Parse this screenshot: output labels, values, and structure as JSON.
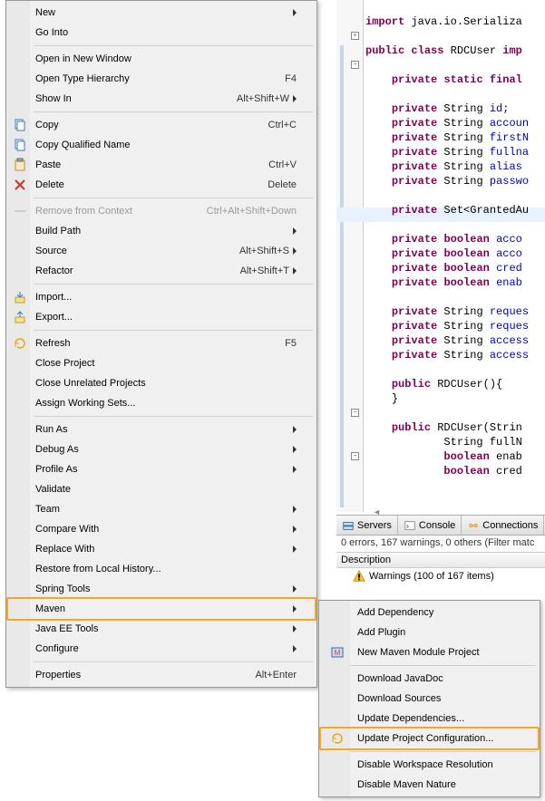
{
  "code": {
    "lines": [
      {
        "indent": 0,
        "tokens": [
          {
            "t": " ",
            "cls": ""
          }
        ]
      },
      {
        "indent": 0,
        "tokens": [
          {
            "t": "import",
            "cls": "kw"
          },
          {
            "t": " java.io.Serializa",
            "cls": ""
          }
        ]
      },
      {
        "indent": 0,
        "tokens": []
      },
      {
        "indent": 0,
        "tokens": [
          {
            "t": "public",
            "cls": "kw"
          },
          {
            "t": " ",
            "cls": ""
          },
          {
            "t": "class",
            "cls": "kw"
          },
          {
            "t": " RDCUser ",
            "cls": ""
          },
          {
            "t": "imp",
            "cls": "kw"
          }
        ]
      },
      {
        "indent": 0,
        "tokens": []
      },
      {
        "indent": 1,
        "tokens": [
          {
            "t": "private",
            "cls": "kw"
          },
          {
            "t": " ",
            "cls": ""
          },
          {
            "t": "static",
            "cls": "kw"
          },
          {
            "t": " ",
            "cls": ""
          },
          {
            "t": "final",
            "cls": "kw"
          }
        ]
      },
      {
        "indent": 0,
        "tokens": []
      },
      {
        "indent": 1,
        "tokens": [
          {
            "t": "private",
            "cls": "kw"
          },
          {
            "t": " String ",
            "cls": ""
          },
          {
            "t": "id",
            "cls": "field"
          },
          {
            "t": ";",
            "cls": ""
          }
        ]
      },
      {
        "indent": 1,
        "tokens": [
          {
            "t": "private",
            "cls": "kw"
          },
          {
            "t": " String ",
            "cls": ""
          },
          {
            "t": "accoun",
            "cls": "field"
          }
        ]
      },
      {
        "indent": 1,
        "tokens": [
          {
            "t": "private",
            "cls": "kw"
          },
          {
            "t": " String ",
            "cls": ""
          },
          {
            "t": "firstN",
            "cls": "field"
          }
        ]
      },
      {
        "indent": 1,
        "tokens": [
          {
            "t": "private",
            "cls": "kw"
          },
          {
            "t": " String ",
            "cls": ""
          },
          {
            "t": "fullna",
            "cls": "field"
          }
        ]
      },
      {
        "indent": 1,
        "tokens": [
          {
            "t": "private",
            "cls": "kw"
          },
          {
            "t": " String ",
            "cls": ""
          },
          {
            "t": "alias",
            "cls": "field"
          }
        ]
      },
      {
        "indent": 1,
        "tokens": [
          {
            "t": "private",
            "cls": "kw"
          },
          {
            "t": " String ",
            "cls": ""
          },
          {
            "t": "passwo",
            "cls": "field"
          }
        ]
      },
      {
        "indent": 0,
        "tokens": [],
        "highlight": true
      },
      {
        "indent": 1,
        "tokens": [
          {
            "t": "private",
            "cls": "kw"
          },
          {
            "t": " Set<GrantedAu",
            "cls": ""
          }
        ]
      },
      {
        "indent": 0,
        "tokens": []
      },
      {
        "indent": 1,
        "tokens": [
          {
            "t": "private",
            "cls": "kw"
          },
          {
            "t": " ",
            "cls": ""
          },
          {
            "t": "boolean",
            "cls": "kw"
          },
          {
            "t": " ",
            "cls": ""
          },
          {
            "t": "acco",
            "cls": "field"
          }
        ]
      },
      {
        "indent": 1,
        "tokens": [
          {
            "t": "private",
            "cls": "kw"
          },
          {
            "t": " ",
            "cls": ""
          },
          {
            "t": "boolean",
            "cls": "kw"
          },
          {
            "t": " ",
            "cls": ""
          },
          {
            "t": "acco",
            "cls": "field"
          }
        ]
      },
      {
        "indent": 1,
        "tokens": [
          {
            "t": "private",
            "cls": "kw"
          },
          {
            "t": " ",
            "cls": ""
          },
          {
            "t": "boolean",
            "cls": "kw"
          },
          {
            "t": " ",
            "cls": ""
          },
          {
            "t": "cred",
            "cls": "field"
          }
        ]
      },
      {
        "indent": 1,
        "tokens": [
          {
            "t": "private",
            "cls": "kw"
          },
          {
            "t": " ",
            "cls": ""
          },
          {
            "t": "boolean",
            "cls": "kw"
          },
          {
            "t": " ",
            "cls": ""
          },
          {
            "t": "enab",
            "cls": "field"
          }
        ]
      },
      {
        "indent": 0,
        "tokens": []
      },
      {
        "indent": 1,
        "tokens": [
          {
            "t": "private",
            "cls": "kw"
          },
          {
            "t": " String ",
            "cls": ""
          },
          {
            "t": "reques",
            "cls": "field"
          }
        ]
      },
      {
        "indent": 1,
        "tokens": [
          {
            "t": "private",
            "cls": "kw"
          },
          {
            "t": " String ",
            "cls": ""
          },
          {
            "t": "reques",
            "cls": "field"
          }
        ]
      },
      {
        "indent": 1,
        "tokens": [
          {
            "t": "private",
            "cls": "kw"
          },
          {
            "t": " String ",
            "cls": ""
          },
          {
            "t": "access",
            "cls": "field"
          }
        ]
      },
      {
        "indent": 1,
        "tokens": [
          {
            "t": "private",
            "cls": "kw"
          },
          {
            "t": " String ",
            "cls": ""
          },
          {
            "t": "access",
            "cls": "field"
          }
        ]
      },
      {
        "indent": 0,
        "tokens": []
      },
      {
        "indent": 1,
        "tokens": [
          {
            "t": "public",
            "cls": "kw"
          },
          {
            "t": " RDCUser(){",
            "cls": ""
          }
        ]
      },
      {
        "indent": 1,
        "tokens": [
          {
            "t": "}",
            "cls": ""
          }
        ]
      },
      {
        "indent": 0,
        "tokens": []
      },
      {
        "indent": 1,
        "tokens": [
          {
            "t": "public",
            "cls": "kw"
          },
          {
            "t": " RDCUser(Strin",
            "cls": ""
          }
        ]
      },
      {
        "indent": 3,
        "tokens": [
          {
            "t": "String fullN",
            "cls": ""
          }
        ]
      },
      {
        "indent": 3,
        "tokens": [
          {
            "t": "boolean",
            "cls": "kw"
          },
          {
            "t": " enab",
            "cls": ""
          }
        ]
      },
      {
        "indent": 3,
        "tokens": [
          {
            "t": "boolean",
            "cls": "kw"
          },
          {
            "t": " cred",
            "cls": ""
          }
        ]
      }
    ]
  },
  "bottom": {
    "tabs": [
      {
        "label": "Servers",
        "icon": "server-icon"
      },
      {
        "label": "Console",
        "icon": "console-icon"
      },
      {
        "label": "Connections",
        "icon": "connections-icon"
      }
    ],
    "filter_text": "0 errors, 167 warnings, 0 others (Filter matc",
    "desc_header": "Description",
    "warn_text": "Warnings (100 of 167 items)"
  },
  "menu": {
    "groups": [
      [
        {
          "label": "New",
          "arrow": true
        },
        {
          "label": "Go Into"
        }
      ],
      [
        {
          "label": "Open in New Window"
        },
        {
          "label": "Open Type Hierarchy",
          "shortcut": "F4"
        },
        {
          "label": "Show In",
          "shortcut": "Alt+Shift+W",
          "arrow": true
        }
      ],
      [
        {
          "label": "Copy",
          "shortcut": "Ctrl+C",
          "icon": "copy-icon"
        },
        {
          "label": "Copy Qualified Name",
          "icon": "copy-q-icon"
        },
        {
          "label": "Paste",
          "shortcut": "Ctrl+V",
          "icon": "paste-icon"
        },
        {
          "label": "Delete",
          "shortcut": "Delete",
          "icon": "delete-icon"
        }
      ],
      [
        {
          "label": "Remove from Context",
          "shortcut": "Ctrl+Alt+Shift+Down",
          "disabled": true,
          "icon": "remove-icon"
        },
        {
          "label": "Build Path",
          "arrow": true
        },
        {
          "label": "Source",
          "shortcut": "Alt+Shift+S",
          "arrow": true
        },
        {
          "label": "Refactor",
          "shortcut": "Alt+Shift+T",
          "arrow": true
        }
      ],
      [
        {
          "label": "Import...",
          "icon": "import-icon"
        },
        {
          "label": "Export...",
          "icon": "export-icon"
        }
      ],
      [
        {
          "label": "Refresh",
          "shortcut": "F5",
          "icon": "refresh-icon"
        },
        {
          "label": "Close Project"
        },
        {
          "label": "Close Unrelated Projects"
        },
        {
          "label": "Assign Working Sets..."
        }
      ],
      [
        {
          "label": "Run As",
          "arrow": true
        },
        {
          "label": "Debug As",
          "arrow": true
        },
        {
          "label": "Profile As",
          "arrow": true
        },
        {
          "label": "Validate"
        },
        {
          "label": "Team",
          "arrow": true
        },
        {
          "label": "Compare With",
          "arrow": true
        },
        {
          "label": "Replace With",
          "arrow": true
        },
        {
          "label": "Restore from Local History..."
        },
        {
          "label": "Spring Tools",
          "arrow": true
        },
        {
          "label": "Maven",
          "arrow": true,
          "highlight": true
        },
        {
          "label": "Java EE Tools",
          "arrow": true
        },
        {
          "label": "Configure",
          "arrow": true
        }
      ],
      [
        {
          "label": "Properties",
          "shortcut": "Alt+Enter"
        }
      ]
    ]
  },
  "submenu": {
    "groups": [
      [
        {
          "label": "Add Dependency"
        },
        {
          "label": "Add Plugin"
        },
        {
          "label": "New Maven Module Project",
          "icon": "maven-module-icon"
        }
      ],
      [
        {
          "label": "Download JavaDoc"
        },
        {
          "label": "Download Sources"
        },
        {
          "label": "Update Dependencies..."
        },
        {
          "label": "Update Project Configuration...",
          "icon": "update-config-icon",
          "highlight": true
        }
      ],
      [
        {
          "label": "Disable Workspace Resolution"
        },
        {
          "label": "Disable Maven Nature"
        }
      ]
    ]
  }
}
